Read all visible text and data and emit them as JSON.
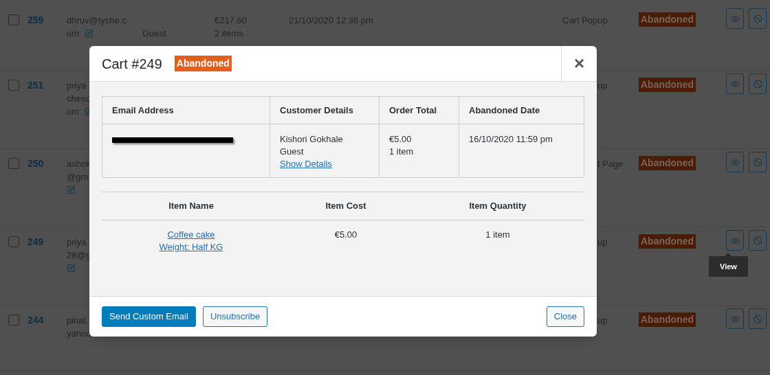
{
  "list_rows": [
    {
      "checked": false,
      "id": "259",
      "email_lines": [
        "dhruv@tyche.c",
        "om"
      ],
      "kind": "inline",
      "customer": "Guest",
      "total_lines": [
        "€217.60",
        "2 items"
      ],
      "date": "21/10/2020 12:36 pm",
      "source": "Cart Popup",
      "source_cut": false,
      "status": "Abandoned"
    },
    {
      "checked": false,
      "id": "251",
      "email_lines": [
        "priya",
        "cheso",
        "om"
      ],
      "kind": "inline",
      "source": "up",
      "source_cut": true,
      "status": "Abandoned"
    },
    {
      "checked": false,
      "id": "250",
      "email_lines": [
        "ashok",
        "@gm"
      ],
      "kind": "below",
      "source": "t Page",
      "source_cut": true,
      "status": "Abandoned"
    },
    {
      "checked": false,
      "id": "249",
      "email_lines": [
        "priya",
        "28@g"
      ],
      "kind": "below",
      "source": "up",
      "source_cut": true,
      "status": "Abandoned",
      "tooltip": "View"
    },
    {
      "checked": false,
      "id": "244",
      "email_lines": [
        "pinal.",
        "yahoo"
      ],
      "kind": "plain",
      "source": "up",
      "source_cut": true,
      "status": "Abandoned"
    }
  ],
  "modal": {
    "title": "Cart #249",
    "status": "Abandoned",
    "close_glyph": "×",
    "summary_table": {
      "columns": [
        "Email Address",
        "Customer Details",
        "Order Total",
        "Abandoned Date"
      ],
      "row": {
        "email_redacted": true,
        "customer_lines": [
          "Kishori Gokhale",
          "Guest"
        ],
        "customer_link": "Show Details",
        "total_lines": [
          "€5.00",
          "1 item"
        ],
        "date": "16/10/2020 11:59 pm"
      }
    },
    "items_table": {
      "columns": [
        "Item Name",
        "Item Cost",
        "Item Quantity"
      ],
      "rows": [
        {
          "name_links": [
            "Coffee cake",
            "Weight: Half KG"
          ],
          "cost": "€5.00",
          "quantity": "1 item"
        }
      ]
    },
    "buttons": [
      {
        "label": "Send Custom Email",
        "kind": "primary"
      },
      {
        "label": "Unsubscribe",
        "kind": "secondary"
      }
    ],
    "close_button": "Close"
  }
}
